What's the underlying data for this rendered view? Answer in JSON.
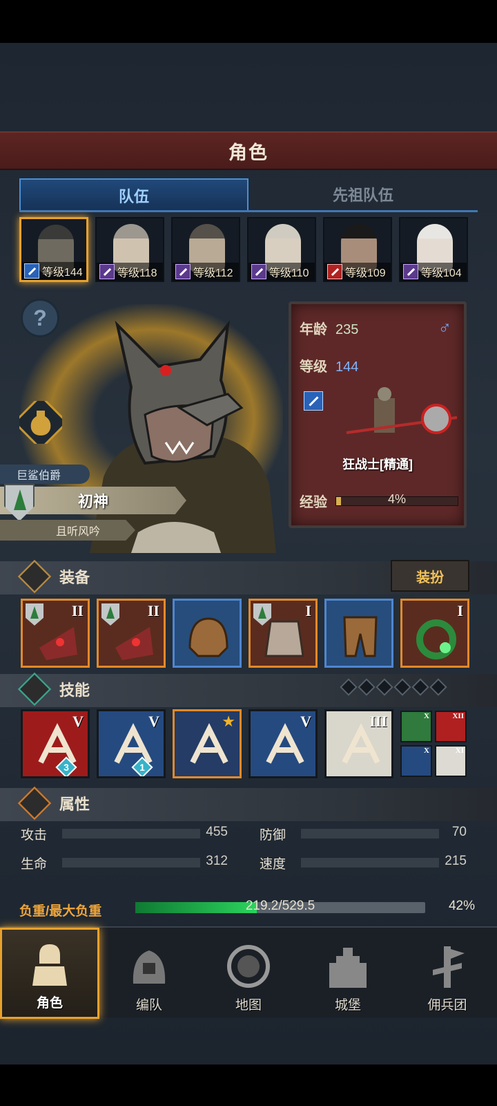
{
  "header": {
    "title": "角色"
  },
  "tabs": [
    {
      "label": "队伍",
      "selected": true
    },
    {
      "label": "先祖队伍",
      "selected": false
    }
  ],
  "roster": [
    {
      "level_text": "等级144",
      "class_color": "blue",
      "selected": true
    },
    {
      "level_text": "等级118",
      "class_color": "purple",
      "selected": false
    },
    {
      "level_text": "等级112",
      "class_color": "purple",
      "selected": false
    },
    {
      "level_text": "等级110",
      "class_color": "purple",
      "selected": false
    },
    {
      "level_text": "等级109",
      "class_color": "red",
      "selected": false
    },
    {
      "level_text": "等级104",
      "class_color": "purple",
      "selected": false
    }
  ],
  "hero": {
    "title": "巨鲨伯爵",
    "name": "初神",
    "subtitle": "且听风吟"
  },
  "info": {
    "age_label": "年龄",
    "age_value": "235",
    "gender_symbol": "♂",
    "level_label": "等级",
    "level_value": "144",
    "class_name": "狂战士[精通]",
    "exp_label": "经验",
    "exp_text": "4%",
    "exp_fraction": 0.04
  },
  "equipment": {
    "label": "装备",
    "dress_button": "装扮",
    "slots": [
      {
        "tier": "orange",
        "roman": "II",
        "badge": true
      },
      {
        "tier": "orange",
        "roman": "II",
        "badge": true
      },
      {
        "tier": "blue",
        "roman": "",
        "badge": false
      },
      {
        "tier": "orange",
        "roman": "I",
        "badge": true
      },
      {
        "tier": "blue",
        "roman": "",
        "badge": false
      },
      {
        "tier": "orange",
        "roman": "I",
        "badge": false
      }
    ]
  },
  "skills": {
    "label": "技能",
    "slot_count": 6,
    "items": [
      {
        "color": "red",
        "roman": "V",
        "gem": "3"
      },
      {
        "color": "blue",
        "roman": "V",
        "gem": "1"
      },
      {
        "color": "gold",
        "roman": "",
        "gem": ""
      },
      {
        "color": "blue",
        "roman": "V",
        "gem": ""
      },
      {
        "color": "gray",
        "roman": "III",
        "gem": ""
      }
    ],
    "mini": [
      {
        "color": "#2f7a3c",
        "roman": "X"
      },
      {
        "color": "#b02020",
        "roman": "XII"
      },
      {
        "color": "#254a80",
        "roman": "X"
      },
      {
        "color": "#dcdad2",
        "roman": "XI"
      }
    ]
  },
  "attributes": {
    "label": "属性",
    "attack_label": "攻击",
    "attack_value": "455",
    "defense_label": "防御",
    "defense_value": "70",
    "hp_label": "生命",
    "hp_value": "312",
    "speed_label": "速度",
    "speed_value": "215",
    "load_label": "负重/最大负重",
    "load_text": "219.2/529.5",
    "load_pct": "42%",
    "load_fraction": 0.42
  },
  "nav": [
    {
      "label": "角色",
      "icon": "knight-icon",
      "selected": true
    },
    {
      "label": "编队",
      "icon": "helmet-icon",
      "selected": false
    },
    {
      "label": "地图",
      "icon": "compass-icon",
      "selected": false
    },
    {
      "label": "城堡",
      "icon": "castle-icon",
      "selected": false
    },
    {
      "label": "佣兵团",
      "icon": "banner-icon",
      "selected": false
    }
  ],
  "colors": {
    "accent_gold": "#e7a12d",
    "tab_blue": "#3f78b6",
    "panel_red": "#5e2828"
  }
}
